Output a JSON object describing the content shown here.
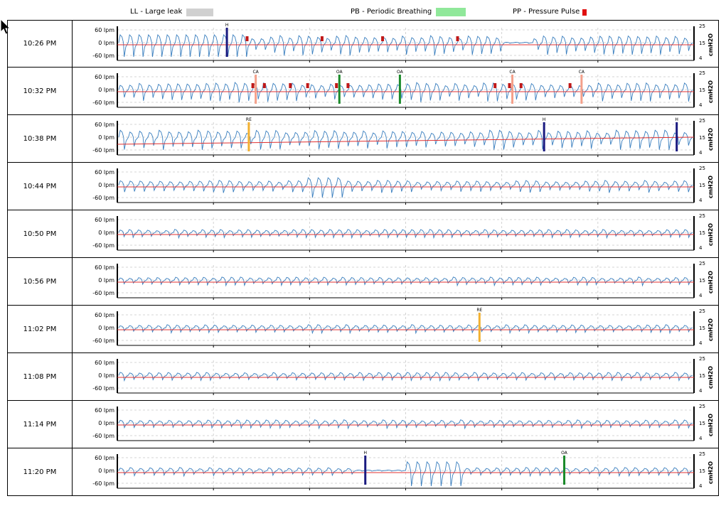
{
  "legend": [
    {
      "id": "ll",
      "label": "LL - Large leak",
      "color": "#d0d0d0",
      "kind": "bar"
    },
    {
      "id": "pb",
      "label": "PB - Periodic Breathing",
      "color": "#90e89a",
      "kind": "bar"
    },
    {
      "id": "pp",
      "label": "PP - Pressure Pulse",
      "color": "#e01010",
      "kind": "square"
    }
  ],
  "colors": {
    "flow": "#3a7fbf",
    "pressure": "#e03030",
    "grid": "#c8c8c8",
    "axis": "#000000"
  },
  "axis": {
    "left_ticks": [
      "60 lpm",
      "0 lpm",
      "-60 lpm"
    ],
    "right_ticks": [
      "25",
      "15",
      "4"
    ],
    "right_label": "cmH2O"
  },
  "chart_data": {
    "type": "line",
    "description_free": true,
    "flow_range_lpm": [
      -60,
      60
    ],
    "pressure_range_cmh2o": [
      4,
      25
    ],
    "rows": [
      {
        "time": "10:26 PM",
        "events": [
          {
            "label": "H",
            "pos": 0.19,
            "color": "#1a1a80"
          }
        ],
        "pressure_pulses": [
          0.225,
          0.355,
          0.46,
          0.59
        ]
      },
      {
        "time": "10:32 PM",
        "events": [
          {
            "label": "CA",
            "pos": 0.24,
            "color": "#f4a08a"
          },
          {
            "label": "OA",
            "pos": 0.385,
            "color": "#1a8a2a"
          },
          {
            "label": "OA",
            "pos": 0.49,
            "color": "#1a8a2a"
          },
          {
            "label": "CA",
            "pos": 0.685,
            "color": "#f4a08a"
          },
          {
            "label": "CA",
            "pos": 0.805,
            "color": "#f4a08a"
          }
        ],
        "pressure_pulses": [
          0.235,
          0.255,
          0.3,
          0.33,
          0.38,
          0.4,
          0.655,
          0.68,
          0.7,
          0.785
        ]
      },
      {
        "time": "10:38 PM",
        "events": [
          {
            "label": "RE",
            "pos": 0.228,
            "color": "#f2b030"
          },
          {
            "label": "H",
            "pos": 0.74,
            "color": "#1a1a80"
          },
          {
            "label": "H",
            "pos": 0.97,
            "color": "#1a1a80"
          }
        ],
        "pressure_pulses": []
      },
      {
        "time": "10:44 PM",
        "events": [],
        "pressure_pulses": []
      },
      {
        "time": "10:50 PM",
        "events": [],
        "pressure_pulses": []
      },
      {
        "time": "10:56 PM",
        "events": [],
        "pressure_pulses": []
      },
      {
        "time": "11:02 PM",
        "events": [
          {
            "label": "RE",
            "pos": 0.628,
            "color": "#f2b030"
          }
        ],
        "pressure_pulses": []
      },
      {
        "time": "11:08 PM",
        "events": [],
        "pressure_pulses": []
      },
      {
        "time": "11:14 PM",
        "events": [],
        "pressure_pulses": []
      },
      {
        "time": "11:20 PM",
        "events": [
          {
            "label": "H",
            "pos": 0.43,
            "color": "#1a1a80"
          },
          {
            "label": "OA",
            "pos": 0.775,
            "color": "#1a8a2a"
          }
        ],
        "pressure_pulses": []
      }
    ]
  }
}
